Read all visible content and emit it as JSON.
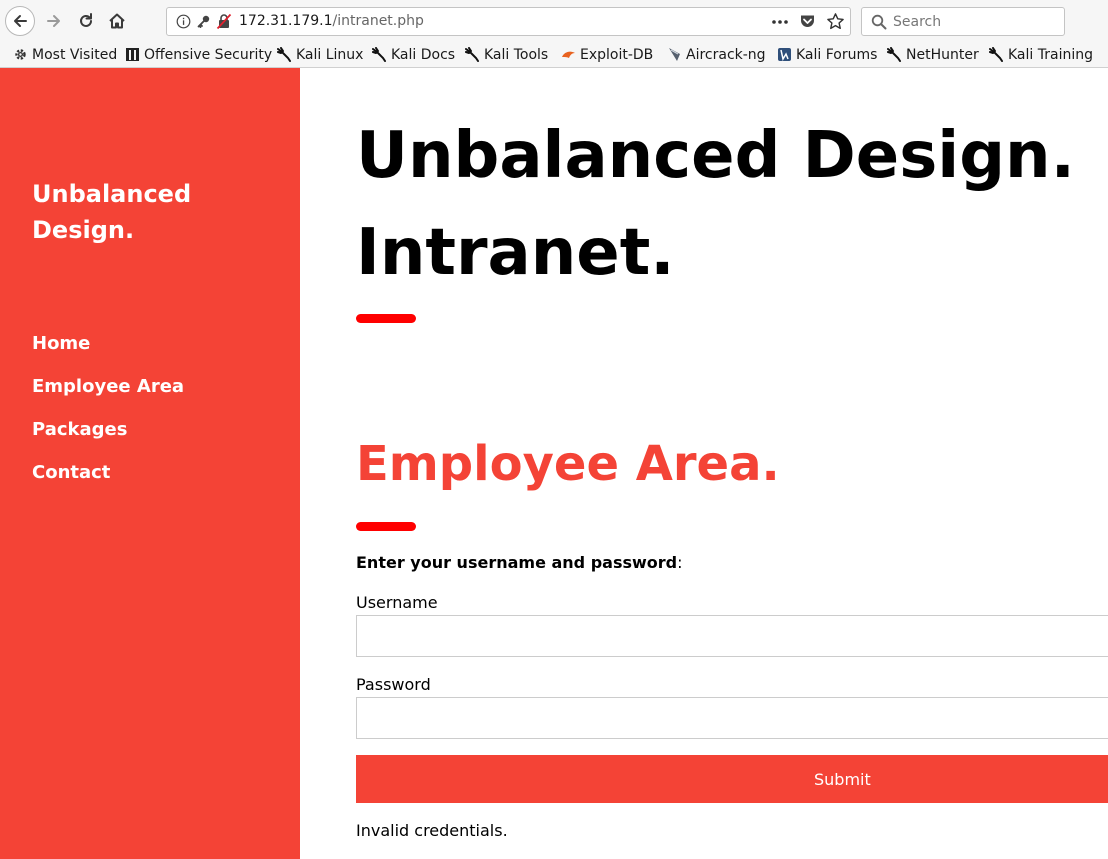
{
  "browser": {
    "url_host": "172.31.179.1",
    "url_path": "/intranet.php",
    "search_placeholder": "Search"
  },
  "bookmarks": [
    {
      "label": "Most Visited",
      "icon": "gear-icon"
    },
    {
      "label": "Offensive Security",
      "icon": "offsec-icon"
    },
    {
      "label": "Kali Linux",
      "icon": "kali-dragon-icon"
    },
    {
      "label": "Kali Docs",
      "icon": "kali-dragon-icon"
    },
    {
      "label": "Kali Tools",
      "icon": "kali-dragon-icon"
    },
    {
      "label": "Exploit-DB",
      "icon": "exploitdb-icon"
    },
    {
      "label": "Aircrack-ng",
      "icon": "aircrack-icon"
    },
    {
      "label": "Kali Forums",
      "icon": "kali-forums-icon"
    },
    {
      "label": "NetHunter",
      "icon": "kali-dragon-icon"
    },
    {
      "label": "Kali Training",
      "icon": "kali-dragon-icon"
    }
  ],
  "sidebar": {
    "title": "Unbalanced Design.",
    "links": [
      {
        "label": "Home"
      },
      {
        "label": "Employee Area"
      },
      {
        "label": "Packages"
      },
      {
        "label": "Contact"
      }
    ]
  },
  "main": {
    "heading": "Unbalanced Design. Intranet.",
    "section_heading": "Employee Area.",
    "prompt_bold": "Enter your username and password",
    "prompt_suffix": ":",
    "username_label": "Username",
    "username_value": "",
    "password_label": "Password",
    "password_value": "",
    "submit_label": "Submit",
    "status": "Invalid credentials."
  },
  "colors": {
    "accent": "#f44336",
    "bar": "#ff0000"
  }
}
